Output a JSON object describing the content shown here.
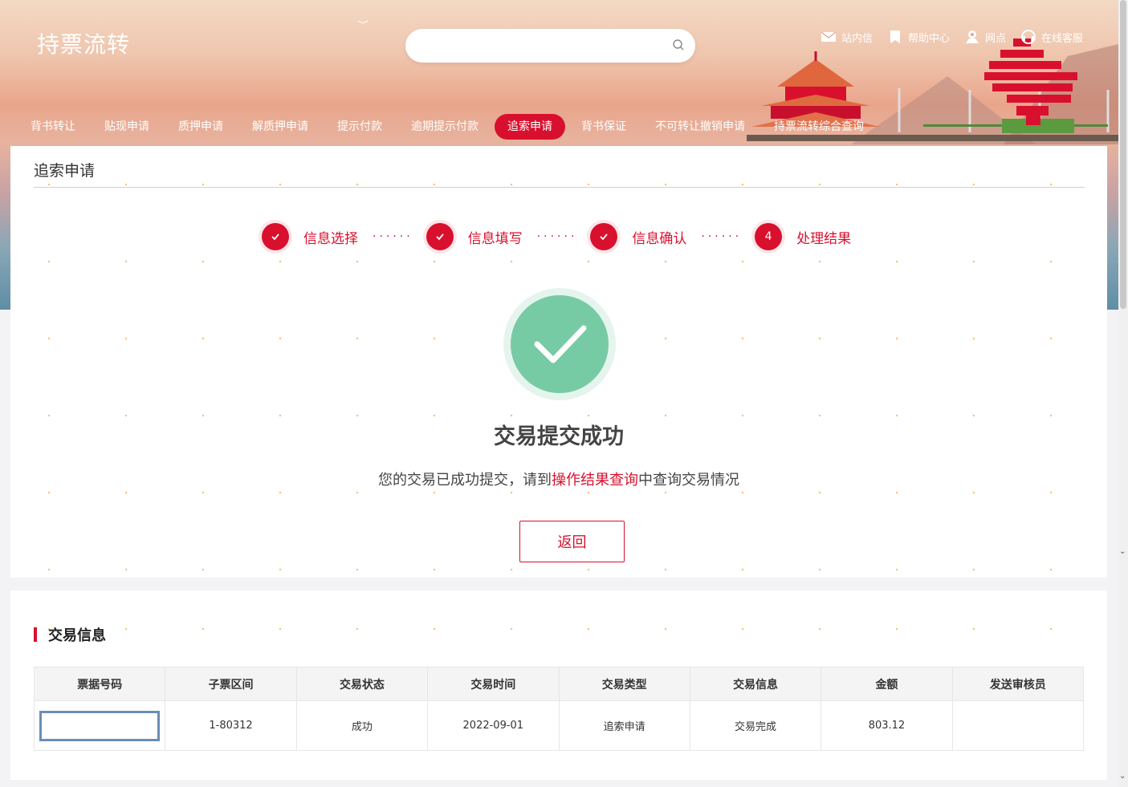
{
  "header": {
    "app_title": "持票流转",
    "search_placeholder": "",
    "top_links": [
      {
        "label": "站内信",
        "icon": "mail-icon"
      },
      {
        "label": "帮助中心",
        "icon": "bookmark-icon"
      },
      {
        "label": "网点",
        "icon": "map-pin-icon"
      },
      {
        "label": "在线客服",
        "icon": "headset-icon"
      }
    ]
  },
  "nav": {
    "items": [
      {
        "label": "背书转让"
      },
      {
        "label": "贴现申请"
      },
      {
        "label": "质押申请"
      },
      {
        "label": "解质押申请"
      },
      {
        "label": "提示付款"
      },
      {
        "label": "逾期提示付款"
      },
      {
        "label": "追索申请"
      },
      {
        "label": "背书保证"
      },
      {
        "label": "不可转让撤销申请"
      },
      {
        "label": "持票流转综合查询"
      }
    ],
    "active_index": 6
  },
  "result_card": {
    "title": "追索申请",
    "steps": [
      {
        "number": "",
        "label": "信息选择",
        "state": "done"
      },
      {
        "number": "",
        "label": "信息填写",
        "state": "done"
      },
      {
        "number": "",
        "label": "信息确认",
        "state": "done"
      },
      {
        "number": "4",
        "label": "处理结果",
        "state": "current"
      }
    ],
    "success_title": "交易提交成功",
    "message_prefix": "您的交易已成功提交，请到",
    "message_link": "操作结果查询",
    "message_suffix": "中查询交易情况",
    "back_label": "返回"
  },
  "transaction": {
    "title": "交易信息",
    "columns": [
      "票据号码",
      "子票区间",
      "交易状态",
      "交易时间",
      "交易类型",
      "交易信息",
      "金额",
      "发送审核员"
    ],
    "row": {
      "ticket_no": "",
      "sub_range": "1-80312",
      "status": "成功",
      "time": "2022-09-01",
      "type": "追索申请",
      "info": "交易完成",
      "amount": "803.12",
      "reviewer": ""
    }
  },
  "colors": {
    "accent": "#d8102e",
    "success": "#77cba4"
  }
}
